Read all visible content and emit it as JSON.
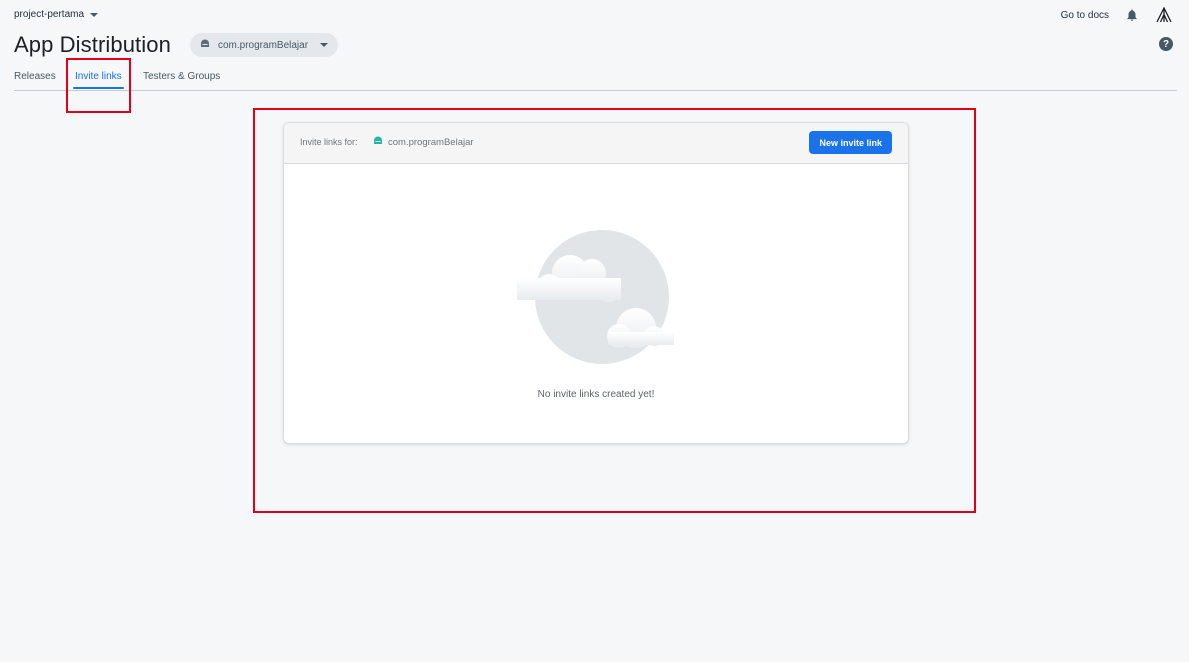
{
  "project": {
    "name": "project-pertama"
  },
  "topbar": {
    "docs_label": "Go to docs"
  },
  "header": {
    "title": "App Distribution",
    "app_selector": "com.programBelajar"
  },
  "tabs": [
    {
      "label": "Releases"
    },
    {
      "label": "Invite links"
    },
    {
      "label": "Testers & Groups"
    }
  ],
  "card": {
    "header_label": "Invite links for:",
    "app_name": "com.programBelajar",
    "new_button": "New invite link",
    "empty_message": "No invite links created yet!"
  },
  "icons": {
    "bell": "bell-icon",
    "logo": "account-logo-icon",
    "help": "help-icon",
    "android": "android-icon",
    "caret": "chevron-down-icon"
  },
  "colors": {
    "accent": "#1a73e8",
    "highlight": "#e0001a",
    "android": "#3ddc84"
  }
}
